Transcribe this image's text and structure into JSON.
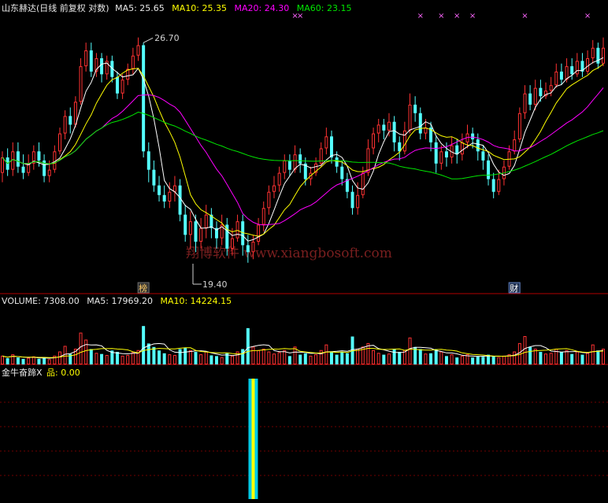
{
  "header": {
    "stock_name": "山东赫达(日线 前复权 对数)",
    "ma5": "MA5: 25.65",
    "ma10": "MA10: 25.35",
    "ma20": "MA20: 24.30",
    "ma60": "MA60: 23.15"
  },
  "volume_header": {
    "volume": "VOLUME: 7308.00",
    "ma5": "MA5: 17969.20",
    "ma10": "MA10: 14224.15"
  },
  "indicator_header": {
    "name": "金牛奋蹄X",
    "value": "品: 0.00"
  },
  "watermark": "翔博软件 www.xiangbosoft.com",
  "annotations": {
    "high_label": "26.70",
    "low_label": "19.40",
    "tag_bang": "榜",
    "tag_cai": "财"
  },
  "colors": {
    "up": "#ff3232",
    "down": "#54ffff",
    "ma5": "#ffffff",
    "ma10": "#ffff00",
    "ma20": "#ff00ff",
    "ma60": "#00e600",
    "divider": "#b00000",
    "grid": "#800000",
    "signal_outer": "#00c8e6",
    "signal_inner": "#ffff00"
  },
  "chart_data": {
    "type": "candlestick",
    "scale": "log",
    "price_range": [
      18.5,
      27.5
    ],
    "volume_range": [
      0,
      80000
    ],
    "indicator_range": [
      0,
      1
    ],
    "candles": [
      [
        21.9,
        22.4,
        22.6,
        21.6,
        12000
      ],
      [
        22.4,
        22.0,
        22.7,
        21.8,
        9000
      ],
      [
        22.0,
        22.6,
        22.9,
        21.8,
        14000
      ],
      [
        22.6,
        22.1,
        22.9,
        21.9,
        10000
      ],
      [
        22.1,
        21.9,
        22.5,
        21.7,
        8000
      ],
      [
        21.9,
        22.2,
        22.5,
        21.8,
        9000
      ],
      [
        22.2,
        22.6,
        22.8,
        22.0,
        11000
      ],
      [
        22.6,
        22.3,
        22.9,
        22.1,
        8000
      ],
      [
        22.3,
        21.8,
        22.5,
        21.6,
        10000
      ],
      [
        21.8,
        22.0,
        22.3,
        21.6,
        7000
      ],
      [
        22.0,
        22.6,
        22.8,
        21.9,
        12000
      ],
      [
        22.6,
        23.2,
        23.4,
        22.5,
        18000
      ],
      [
        23.2,
        23.8,
        24.0,
        23.0,
        26000
      ],
      [
        23.8,
        23.5,
        24.1,
        23.2,
        15000
      ],
      [
        23.5,
        24.3,
        24.5,
        23.4,
        22000
      ],
      [
        24.3,
        25.6,
        25.9,
        24.2,
        45000
      ],
      [
        25.6,
        26.2,
        26.5,
        25.4,
        35000
      ],
      [
        26.2,
        25.4,
        26.5,
        25.2,
        22000
      ],
      [
        25.4,
        25.9,
        26.1,
        25.2,
        16000
      ],
      [
        25.9,
        25.3,
        26.1,
        25.0,
        15000
      ],
      [
        25.3,
        25.8,
        26.0,
        25.1,
        13000
      ],
      [
        25.8,
        25.2,
        26.0,
        25.0,
        20000
      ],
      [
        25.2,
        24.6,
        25.4,
        24.4,
        18000
      ],
      [
        24.6,
        25.1,
        25.3,
        24.4,
        12000
      ],
      [
        25.1,
        25.5,
        25.7,
        24.9,
        13000
      ],
      [
        25.5,
        26.0,
        26.3,
        25.3,
        17000
      ],
      [
        26.0,
        26.4,
        26.7,
        25.8,
        20000
      ],
      [
        26.4,
        22.6,
        26.5,
        22.4,
        55000
      ],
      [
        22.6,
        22.0,
        22.9,
        21.6,
        30000
      ],
      [
        22.0,
        21.5,
        22.3,
        21.3,
        25000
      ],
      [
        21.5,
        21.2,
        21.8,
        21.0,
        20000
      ],
      [
        21.2,
        21.0,
        21.5,
        20.8,
        16000
      ],
      [
        21.0,
        21.3,
        21.6,
        20.8,
        14000
      ],
      [
        21.3,
        21.5,
        21.8,
        21.0,
        13000
      ],
      [
        21.5,
        20.6,
        21.7,
        20.4,
        22000
      ],
      [
        20.6,
        20.0,
        20.9,
        19.8,
        24000
      ],
      [
        20.0,
        20.4,
        20.7,
        19.6,
        20000
      ],
      [
        20.4,
        19.8,
        20.6,
        19.5,
        18000
      ],
      [
        19.8,
        20.2,
        20.5,
        19.6,
        14000
      ],
      [
        20.2,
        20.6,
        20.9,
        19.9,
        18000
      ],
      [
        20.6,
        20.2,
        20.8,
        19.9,
        13000
      ],
      [
        20.2,
        19.9,
        20.4,
        19.6,
        12000
      ],
      [
        19.9,
        20.3,
        20.6,
        19.7,
        10000
      ],
      [
        20.3,
        19.6,
        20.5,
        19.4,
        16000
      ],
      [
        19.6,
        19.9,
        20.2,
        19.4,
        12000
      ],
      [
        19.9,
        20.4,
        20.6,
        19.8,
        18000
      ],
      [
        20.4,
        19.7,
        20.6,
        19.4,
        22000
      ],
      [
        19.7,
        19.5,
        20.0,
        19.2,
        52000
      ],
      [
        19.5,
        19.8,
        20.0,
        19.3,
        25000
      ],
      [
        19.8,
        20.3,
        20.5,
        19.7,
        20000
      ],
      [
        20.3,
        20.8,
        21.0,
        20.1,
        22000
      ],
      [
        20.8,
        21.3,
        21.5,
        20.6,
        18000
      ],
      [
        21.3,
        21.5,
        21.8,
        21.1,
        15000
      ],
      [
        21.5,
        21.9,
        22.1,
        21.3,
        17000
      ],
      [
        21.9,
        22.3,
        22.5,
        21.7,
        20000
      ],
      [
        22.3,
        22.0,
        22.5,
        21.8,
        12000
      ],
      [
        22.0,
        22.5,
        22.8,
        21.9,
        25000
      ],
      [
        22.5,
        22.2,
        22.7,
        21.9,
        14000
      ],
      [
        22.2,
        21.7,
        22.4,
        21.5,
        16000
      ],
      [
        21.7,
        21.9,
        22.1,
        21.5,
        12000
      ],
      [
        21.9,
        22.2,
        22.4,
        21.8,
        14000
      ],
      [
        22.2,
        22.7,
        22.9,
        22.1,
        20000
      ],
      [
        22.7,
        23.1,
        23.4,
        22.5,
        28000
      ],
      [
        23.1,
        22.4,
        23.3,
        22.2,
        18000
      ],
      [
        22.4,
        22.1,
        22.6,
        21.9,
        14000
      ],
      [
        22.1,
        21.7,
        22.3,
        21.5,
        18000
      ],
      [
        21.7,
        21.3,
        21.9,
        21.1,
        16000
      ],
      [
        21.3,
        20.8,
        21.5,
        20.6,
        40000
      ],
      [
        20.8,
        21.2,
        21.6,
        20.6,
        22000
      ],
      [
        21.2,
        21.9,
        22.1,
        21.1,
        25000
      ],
      [
        21.9,
        22.7,
        23.0,
        21.8,
        30000
      ],
      [
        22.7,
        23.2,
        23.4,
        22.5,
        20000
      ],
      [
        23.2,
        23.5,
        23.7,
        22.9,
        16000
      ],
      [
        23.5,
        23.3,
        23.7,
        23.0,
        14000
      ],
      [
        23.3,
        23.6,
        23.9,
        23.1,
        15000
      ],
      [
        23.6,
        22.9,
        23.8,
        22.6,
        22000
      ],
      [
        22.9,
        22.6,
        23.1,
        22.3,
        18000
      ],
      [
        22.6,
        23.3,
        23.6,
        22.5,
        20000
      ],
      [
        23.3,
        24.2,
        24.6,
        23.2,
        38000
      ],
      [
        24.2,
        23.9,
        24.5,
        23.6,
        25000
      ],
      [
        23.9,
        23.2,
        24.1,
        23.0,
        22000
      ],
      [
        23.2,
        23.4,
        23.7,
        23.0,
        15000
      ],
      [
        23.4,
        22.9,
        23.6,
        22.6,
        16000
      ],
      [
        22.9,
        22.2,
        23.1,
        21.9,
        22000
      ],
      [
        22.2,
        22.6,
        22.8,
        22.0,
        18000
      ],
      [
        22.6,
        22.4,
        22.9,
        22.1,
        12000
      ],
      [
        22.4,
        22.8,
        23.1,
        22.2,
        14000
      ],
      [
        22.8,
        22.5,
        23.0,
        22.2,
        10000
      ],
      [
        22.5,
        22.9,
        23.2,
        22.3,
        12000
      ],
      [
        22.9,
        23.2,
        23.5,
        22.7,
        14000
      ],
      [
        23.2,
        23.0,
        23.4,
        22.7,
        10000
      ],
      [
        23.0,
        22.6,
        23.2,
        22.3,
        12000
      ],
      [
        22.6,
        22.3,
        22.8,
        22.0,
        11000
      ],
      [
        22.3,
        21.7,
        22.5,
        21.5,
        14000
      ],
      [
        21.7,
        21.3,
        21.9,
        21.1,
        12000
      ],
      [
        21.3,
        21.7,
        22.0,
        21.2,
        10000
      ],
      [
        21.7,
        22.1,
        22.3,
        21.5,
        12000
      ],
      [
        22.1,
        22.6,
        22.8,
        22.0,
        14000
      ],
      [
        22.6,
        23.0,
        23.3,
        22.5,
        18000
      ],
      [
        23.0,
        23.9,
        24.1,
        22.9,
        30000
      ],
      [
        23.9,
        24.6,
        24.9,
        23.7,
        40000
      ],
      [
        24.6,
        24.2,
        24.9,
        24.0,
        25000
      ],
      [
        24.2,
        24.8,
        25.1,
        24.0,
        22000
      ],
      [
        24.8,
        24.5,
        25.1,
        24.3,
        18000
      ],
      [
        24.5,
        24.7,
        25.0,
        24.4,
        15000
      ],
      [
        24.7,
        24.9,
        25.2,
        24.5,
        16000
      ],
      [
        24.9,
        25.4,
        25.7,
        24.8,
        22000
      ],
      [
        25.4,
        25.1,
        25.7,
        24.9,
        18000
      ],
      [
        25.1,
        25.6,
        25.9,
        25.0,
        20000
      ],
      [
        25.6,
        25.3,
        25.9,
        25.1,
        15000
      ],
      [
        25.3,
        25.8,
        26.1,
        25.2,
        18000
      ],
      [
        25.8,
        25.4,
        26.1,
        25.2,
        14000
      ],
      [
        25.4,
        25.9,
        26.2,
        25.3,
        16000
      ],
      [
        25.9,
        26.3,
        26.6,
        25.7,
        28000
      ],
      [
        26.3,
        25.7,
        26.5,
        25.5,
        20000
      ],
      [
        25.7,
        26.3,
        26.7,
        25.6,
        22000
      ]
    ],
    "ma_series": [
      {
        "name": "MA5",
        "color_key": "ma5"
      },
      {
        "name": "MA10",
        "color_key": "ma10"
      },
      {
        "name": "MA20",
        "color_key": "ma20"
      },
      {
        "name": "MA60",
        "color_key": "ma60"
      }
    ],
    "marker_indices": [
      56,
      57,
      80,
      84,
      87,
      90,
      100,
      112
    ],
    "high_index": 27,
    "low_index": 47,
    "tag_bang_index": 27,
    "tag_cai_index": 98,
    "signal_index": 48,
    "signal_value": 1
  }
}
